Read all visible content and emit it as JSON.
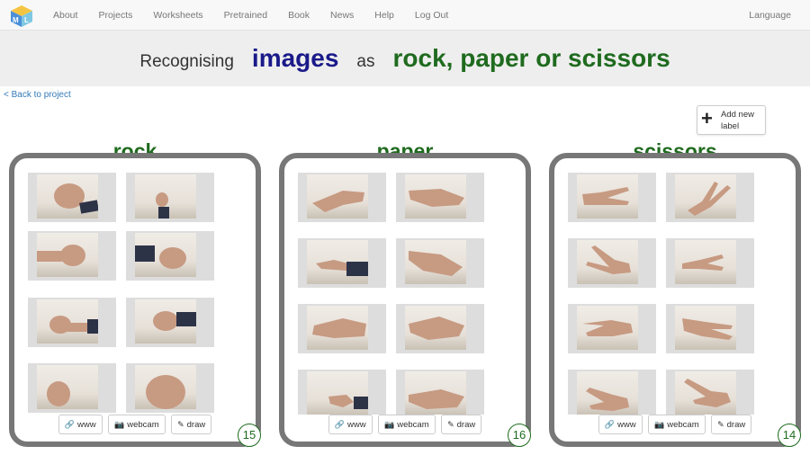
{
  "nav": {
    "links": [
      "About",
      "Projects",
      "Worksheets",
      "Pretrained",
      "Book",
      "News",
      "Help",
      "Log Out"
    ],
    "language": "Language",
    "logo_text": "ML"
  },
  "title": {
    "prefix": "Recognising",
    "type": "images",
    "middle": "as",
    "labels": "rock, paper or scissors"
  },
  "back_link": "< Back to project",
  "add_label": {
    "icon": "plus-icon",
    "text": "Add new label"
  },
  "buckets": [
    {
      "label": "rock",
      "count": "15"
    },
    {
      "label": "paper",
      "count": "16"
    },
    {
      "label": "scissors",
      "count": "14"
    }
  ],
  "buttons": {
    "www": "www",
    "webcam": "webcam",
    "draw": "draw"
  },
  "colors": {
    "label_green": "#1f6b1f",
    "type_blue": "#1a1a8a",
    "bucket_border": "#777777"
  }
}
